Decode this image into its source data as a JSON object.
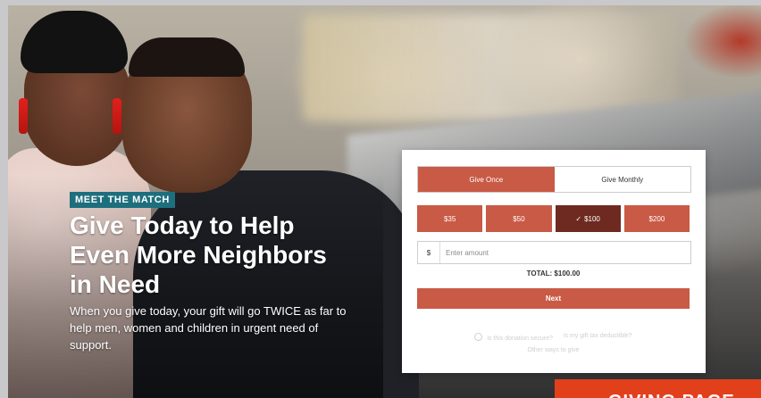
{
  "hero": {
    "badge": "MEET THE MATCH",
    "headline": "Give Today to Help Even More Neighbors in Need",
    "subtext": "When you give today, your gift will go TWICE as far to help men, women and children in urgent need of support."
  },
  "donation_form": {
    "frequency_options": [
      "Give Once",
      "Give Monthly"
    ],
    "selected_frequency": "Give Once",
    "amounts": [
      "$35",
      "$50",
      "$100",
      "$200"
    ],
    "selected_amount": "$100",
    "currency_symbol": "$",
    "amount_placeholder": "Enter amount",
    "total": "TOTAL: $100.00",
    "next_label": "Next",
    "secure_text_1": "is this donation secure?",
    "secure_text_2": "is my gift tax deductible?",
    "other_ways": "Other ways to give"
  },
  "giving_button": {
    "label": "GIVING PAGE"
  },
  "colors": {
    "accent": "#c95a45",
    "accent_selected": "#6e2a20",
    "badge": "#1d6f7d",
    "cta_orange": "#e2401b"
  },
  "icons": {
    "selected_check": "check-icon",
    "secure": "lock-icon"
  }
}
